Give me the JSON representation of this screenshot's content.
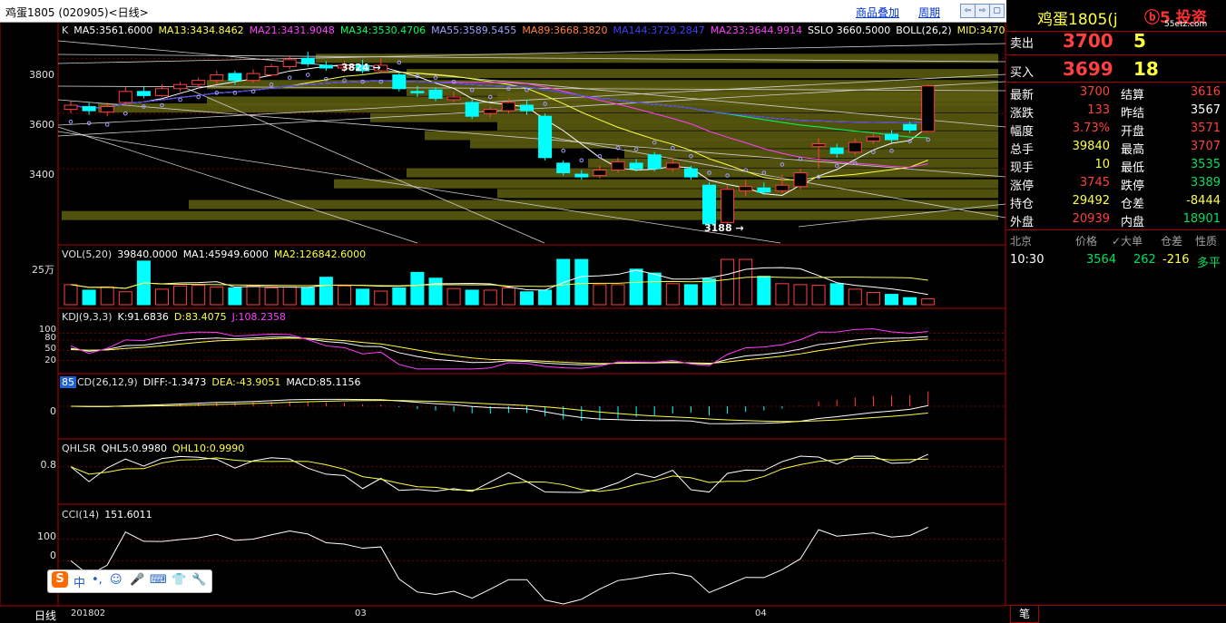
{
  "window": {
    "title": "鸡蛋1805 (020905)<日线>",
    "links": [
      "商品叠加",
      "周期"
    ],
    "buttons": [
      "⇦",
      "⇨",
      "▢"
    ]
  },
  "indicators": {
    "k": {
      "name": "K",
      "items": [
        {
          "text": "MA5:3561.6000",
          "color": "#ffffff"
        },
        {
          "text": "MA13:3434.8462",
          "color": "#ffff40"
        },
        {
          "text": "MA21:3431.9048",
          "color": "#ff40ff"
        },
        {
          "text": "MA34:3530.4706",
          "color": "#00ff60"
        },
        {
          "text": "MA55:3589.5455",
          "color": "#a0a0ff"
        },
        {
          "text": "MA89:3668.3820",
          "color": "#ff8040"
        },
        {
          "text": "MA144:3729.2847",
          "color": "#4040ff"
        },
        {
          "text": "MA233:3644.9914",
          "color": "#ff40ff"
        },
        {
          "text": "SSLO 3660.5000",
          "color": "#ffffff"
        },
        {
          "text": "BOLL(26,2)",
          "color": "#ffffff"
        },
        {
          "text": "MID:3470",
          "color": "#ffff40"
        }
      ]
    },
    "vol": {
      "name": "VOL(5,20)",
      "items": [
        {
          "text": "39840.0000",
          "color": "#ffffff"
        },
        {
          "text": "MA1:45949.6000",
          "color": "#ffffff"
        },
        {
          "text": "MA2:126842.6000",
          "color": "#ffff40"
        }
      ]
    },
    "kdj": {
      "name": "KDJ(9,3,3)",
      "items": [
        {
          "text": "K:91.6836",
          "color": "#ffffff"
        },
        {
          "text": "D:83.4075",
          "color": "#ffff40"
        },
        {
          "text": "J:108.2358",
          "color": "#ff40ff"
        }
      ]
    },
    "macd": {
      "name": "CD(26,12,9)",
      "badge": "85",
      "items": [
        {
          "text": "DIFF:-1.3473",
          "color": "#ffffff"
        },
        {
          "text": "DEA:-43.9051",
          "color": "#ffff40"
        },
        {
          "text": "MACD:85.1156",
          "color": "#ffffff"
        }
      ]
    },
    "qhlsr": {
      "name": "QHLSR",
      "items": [
        {
          "text": "QHL5:0.9980",
          "color": "#ffffff"
        },
        {
          "text": "QHL10:0.9990",
          "color": "#ffff40"
        }
      ]
    },
    "cci": {
      "name": "CCI(14)",
      "items": [
        {
          "text": "151.6011",
          "color": "#ffffff"
        }
      ]
    }
  },
  "axes": {
    "price_ticks": [
      "3800",
      "3600",
      "3400"
    ],
    "vol_tick": "25万",
    "kdj_ticks": [
      "100",
      "80",
      "50",
      "20"
    ],
    "macd_tick": "0",
    "qhlsr_tick": "0.8",
    "cci_ticks": [
      "100",
      "0"
    ],
    "date_labels": [
      "201802",
      "03",
      "04"
    ],
    "period": "日线"
  },
  "markers": {
    "high": "3824",
    "low": "3188"
  },
  "chart_data": {
    "type": "candlestick",
    "candles": [
      {
        "o": 3615,
        "c": 3630,
        "h": 3645,
        "l": 3600
      },
      {
        "o": 3625,
        "c": 3610,
        "h": 3640,
        "l": 3595
      },
      {
        "o": 3605,
        "c": 3625,
        "h": 3640,
        "l": 3590
      },
      {
        "o": 3640,
        "c": 3680,
        "h": 3695,
        "l": 3630
      },
      {
        "o": 3680,
        "c": 3665,
        "h": 3700,
        "l": 3655
      },
      {
        "o": 3665,
        "c": 3690,
        "h": 3705,
        "l": 3660
      },
      {
        "o": 3690,
        "c": 3705,
        "h": 3715,
        "l": 3680
      },
      {
        "o": 3705,
        "c": 3720,
        "h": 3730,
        "l": 3690
      },
      {
        "o": 3720,
        "c": 3740,
        "h": 3755,
        "l": 3705
      },
      {
        "o": 3745,
        "c": 3720,
        "h": 3755,
        "l": 3705
      },
      {
        "o": 3720,
        "c": 3745,
        "h": 3760,
        "l": 3710
      },
      {
        "o": 3740,
        "c": 3770,
        "h": 3780,
        "l": 3735
      },
      {
        "o": 3770,
        "c": 3795,
        "h": 3810,
        "l": 3760
      },
      {
        "o": 3800,
        "c": 3780,
        "h": 3824,
        "l": 3770
      },
      {
        "o": 3775,
        "c": 3765,
        "h": 3790,
        "l": 3755
      },
      {
        "o": 3765,
        "c": 3775,
        "h": 3790,
        "l": 3750
      },
      {
        "o": 3775,
        "c": 3755,
        "h": 3795,
        "l": 3745
      },
      {
        "o": 3755,
        "c": 3775,
        "h": 3800,
        "l": 3745
      },
      {
        "o": 3740,
        "c": 3690,
        "h": 3750,
        "l": 3680
      },
      {
        "o": 3680,
        "c": 3675,
        "h": 3700,
        "l": 3660
      },
      {
        "o": 3685,
        "c": 3655,
        "h": 3695,
        "l": 3645
      },
      {
        "o": 3650,
        "c": 3660,
        "h": 3680,
        "l": 3640
      },
      {
        "o": 3640,
        "c": 3590,
        "h": 3650,
        "l": 3580
      },
      {
        "o": 3600,
        "c": 3615,
        "h": 3625,
        "l": 3585
      },
      {
        "o": 3610,
        "c": 3640,
        "h": 3655,
        "l": 3600
      },
      {
        "o": 3630,
        "c": 3610,
        "h": 3650,
        "l": 3595
      },
      {
        "o": 3590,
        "c": 3440,
        "h": 3600,
        "l": 3430
      },
      {
        "o": 3420,
        "c": 3385,
        "h": 3430,
        "l": 3375
      },
      {
        "o": 3380,
        "c": 3370,
        "h": 3395,
        "l": 3360
      },
      {
        "o": 3375,
        "c": 3395,
        "h": 3410,
        "l": 3365
      },
      {
        "o": 3395,
        "c": 3425,
        "h": 3440,
        "l": 3385
      },
      {
        "o": 3420,
        "c": 3400,
        "h": 3435,
        "l": 3390
      },
      {
        "o": 3450,
        "c": 3400,
        "h": 3460,
        "l": 3390
      },
      {
        "o": 3400,
        "c": 3420,
        "h": 3440,
        "l": 3390
      },
      {
        "o": 3400,
        "c": 3370,
        "h": 3410,
        "l": 3360
      },
      {
        "o": 3340,
        "c": 3200,
        "h": 3350,
        "l": 3188
      },
      {
        "o": 3205,
        "c": 3325,
        "h": 3340,
        "l": 3195
      },
      {
        "o": 3320,
        "c": 3335,
        "h": 3360,
        "l": 3300
      },
      {
        "o": 3330,
        "c": 3315,
        "h": 3350,
        "l": 3305
      },
      {
        "o": 3320,
        "c": 3340,
        "h": 3380,
        "l": 3310
      },
      {
        "o": 3335,
        "c": 3385,
        "h": 3400,
        "l": 3325
      },
      {
        "o": 3480,
        "c": 3490,
        "h": 3510,
        "l": 3400
      },
      {
        "o": 3475,
        "c": 3455,
        "h": 3490,
        "l": 3440
      },
      {
        "o": 3460,
        "c": 3495,
        "h": 3510,
        "l": 3450
      },
      {
        "o": 3500,
        "c": 3515,
        "h": 3530,
        "l": 3490
      },
      {
        "o": 3525,
        "c": 3505,
        "h": 3540,
        "l": 3495
      },
      {
        "o": 3560,
        "c": 3540,
        "h": 3570,
        "l": 3530
      },
      {
        "o": 3535,
        "c": 3700,
        "h": 3707,
        "l": 3535
      }
    ],
    "volume": [
      62,
      45,
      55,
      40,
      135,
      48,
      58,
      60,
      55,
      52,
      58,
      52,
      55,
      52,
      85,
      58,
      48,
      42,
      52,
      100,
      82,
      50,
      45,
      45,
      52,
      40,
      45,
      160,
      140,
      62,
      62,
      110,
      98,
      65,
      62,
      80,
      165,
      175,
      88,
      65,
      62,
      60,
      65,
      48,
      38,
      32,
      22,
      18
    ],
    "price_ylim": [
      3150,
      3880
    ],
    "vol_ylim": [
      0,
      200
    ],
    "kdj_ylim": [
      0,
      120
    ],
    "qhlsr_ylim": [
      0.3,
      1.05
    ],
    "cci_ylim": [
      -200,
      220
    ],
    "macd_ylim": [
      -160,
      140
    ]
  },
  "panel": {
    "logo": "ⓑ5 投资",
    "logo_sub": "55etz.com",
    "title": "鸡蛋1805(j",
    "sell": {
      "label": "卖出",
      "price": "3700",
      "qty": "5"
    },
    "buy": {
      "label": "买入",
      "price": "3699",
      "qty": "18"
    },
    "rows": [
      {
        "l1": "最新",
        "v1": "3700",
        "c1": "red",
        "l2": "结算",
        "v2": "3616",
        "c2": "red"
      },
      {
        "l1": "涨跌",
        "v1": "133",
        "c1": "red",
        "l2": "昨结",
        "v2": "3567",
        "c2": "wht"
      },
      {
        "l1": "幅度",
        "v1": "3.73%",
        "c1": "red",
        "l2": "开盘",
        "v2": "3571",
        "c2": "red"
      },
      {
        "l1": "总手",
        "v1": "39840",
        "c1": "yel",
        "l2": "最高",
        "v2": "3707",
        "c2": "red"
      },
      {
        "l1": "现手",
        "v1": "10",
        "c1": "yel",
        "l2": "最低",
        "v2": "3535",
        "c2": "grn"
      },
      {
        "l1": "涨停",
        "v1": "3745",
        "c1": "red",
        "l2": "跌停",
        "v2": "3389",
        "c2": "grn"
      },
      {
        "l1": "持仓",
        "v1": "29492",
        "c1": "yel",
        "l2": "仓差",
        "v2": "-8444",
        "c2": "yel"
      },
      {
        "l1": "外盘",
        "v1": "20939",
        "c1": "red",
        "l2": "内盘",
        "v2": "18901",
        "c2": "grn"
      }
    ],
    "tick_headers": [
      "北京",
      "价格",
      "✓大单",
      "仓差",
      "性质"
    ],
    "tick_row": {
      "time": "10:30",
      "price": "3564",
      "big": "262",
      "diff": "-216",
      "nature": "多平"
    },
    "bottom_tab": "笔"
  },
  "ime": {
    "items": [
      "中",
      "•,",
      "☺",
      "🎤",
      "⌨",
      "👕",
      "🔧"
    ]
  }
}
